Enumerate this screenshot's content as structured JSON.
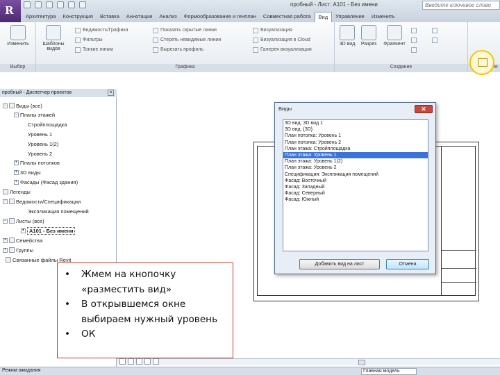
{
  "title_bar": {
    "document_title": "пробный - Лист: A101 - Без имени",
    "search_placeholder": "Введите ключевое слово"
  },
  "ribbon": {
    "tabs": [
      "Архитектура",
      "Конструкция",
      "Вставка",
      "Аннотации",
      "Анализ",
      "Формообразование и генплан",
      "Совместная работа",
      "Вид",
      "Управление",
      "Изменить"
    ],
    "active_tab": "Вид",
    "groups": {
      "select": {
        "label": "Выбор",
        "modify_label": "Изменить"
      },
      "graphics": {
        "label": "Графика",
        "templates_label": "Шаблоны видов",
        "items": [
          "Видимость/Графика",
          "Фильтры",
          "Тонкие линии",
          "Показать скрытые линии",
          "Стереть невидимые линии",
          "Вырезать профиль"
        ],
        "column3": [
          "Визуализация",
          "Визуализация в Cloud",
          "Галерея визуализации"
        ]
      },
      "create": {
        "label": "Создание",
        "items": [
          "3D вид",
          "Разрез",
          "Фрагмент"
        ]
      },
      "composition": {
        "label": "Композиция"
      }
    }
  },
  "project_browser": {
    "title": "пробный - Диспетчер проектов",
    "close_glyph": "×",
    "items": [
      {
        "label": "Виды (все)"
      },
      {
        "label": "Планы этажей"
      },
      {
        "label": "Стройплощадка"
      },
      {
        "label": "Уровень 1"
      },
      {
        "label": "Уровень 1(2)"
      },
      {
        "label": "Уровень 2"
      },
      {
        "label": "Планы потолков"
      },
      {
        "label": "3D виды"
      },
      {
        "label": "Фасады (Фасад здания)"
      },
      {
        "label": "Легенды"
      },
      {
        "label": "Ведомости/Спецификации"
      },
      {
        "label": "Экспликация помещений"
      },
      {
        "label": "Листы (все)"
      },
      {
        "label": "A101 - Без имени"
      },
      {
        "label": "Семейства"
      },
      {
        "label": "Группы"
      },
      {
        "label": "Связанные файлы Revit"
      }
    ]
  },
  "dialog": {
    "title": "Виды",
    "close_glyph": "✕",
    "views": [
      "3D вид: 3D вид 1",
      "3D вид: {3D}",
      "План потолка: Уровень 1",
      "План потолка: Уровень 2",
      "План этажа: Стройплощадка",
      "План этажа: Уровень 1",
      "План этажа: Уровень 1(2)",
      "План этажа: Уровень 2",
      "Спецификация: Экспликация помещений",
      "Фасад: Восточный",
      "Фасад: Западный",
      "Фасад: Северный",
      "Фасад: Южный"
    ],
    "selected_index": 5,
    "add_button": "Добавить вид на лист",
    "cancel_button": "Отмена"
  },
  "annotation": {
    "bullets": [
      {
        "line1": "Жмем на кнопочку",
        "line2": "«разместить вид»"
      },
      {
        "line1": "В открывшемся окне",
        "line2": "выбираем нужный уровень"
      },
      {
        "line1": "ОК",
        "line2": ""
      }
    ]
  },
  "status_bar": {
    "text": "Режим ожидания",
    "model": "Главная модель"
  }
}
